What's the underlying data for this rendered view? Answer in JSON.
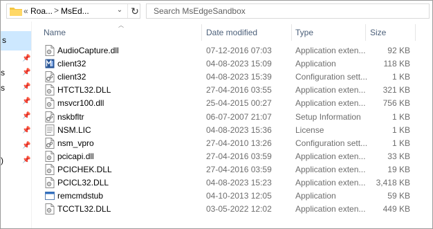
{
  "address": {
    "overflow": "«",
    "crumbs": [
      "Roa...",
      "MsEd..."
    ],
    "separator": ">",
    "dropdown": "⌄",
    "refresh": "↻"
  },
  "search": {
    "placeholder": "Search MsEdgeSandbox"
  },
  "nav": {
    "selected_fragment": "s",
    "fragments": [
      "s",
      "s",
      "s",
      ")"
    ]
  },
  "columns": {
    "name": "Name",
    "date": "Date modified",
    "type": "Type",
    "size": "Size"
  },
  "files": [
    {
      "name": "AudioCapture.dll",
      "date": "07-12-2016 07:03",
      "type": "Application exten...",
      "size": "92 KB",
      "icon": "dll-file-icon"
    },
    {
      "name": "client32",
      "date": "04-08-2023 15:09",
      "type": "Application",
      "size": "118 KB",
      "icon": "app-exe-icon"
    },
    {
      "name": "client32",
      "date": "04-08-2023 15:39",
      "type": "Configuration sett...",
      "size": "1 KB",
      "icon": "config-file-icon"
    },
    {
      "name": "HTCTL32.DLL",
      "date": "27-04-2016 03:55",
      "type": "Application exten...",
      "size": "321 KB",
      "icon": "dll-file-icon"
    },
    {
      "name": "msvcr100.dll",
      "date": "25-04-2015 00:27",
      "type": "Application exten...",
      "size": "756 KB",
      "icon": "dll-file-icon"
    },
    {
      "name": "nskbfltr",
      "date": "06-07-2007 21:07",
      "type": "Setup Information",
      "size": "1 KB",
      "icon": "setup-info-icon"
    },
    {
      "name": "NSM.LIC",
      "date": "04-08-2023 15:36",
      "type": "License",
      "size": "1 KB",
      "icon": "license-file-icon"
    },
    {
      "name": "nsm_vpro",
      "date": "27-04-2010 13:26",
      "type": "Configuration sett...",
      "size": "1 KB",
      "icon": "config-file-icon"
    },
    {
      "name": "pcicapi.dll",
      "date": "27-04-2016 03:59",
      "type": "Application exten...",
      "size": "33 KB",
      "icon": "dll-file-icon"
    },
    {
      "name": "PCICHEK.DLL",
      "date": "27-04-2016 03:59",
      "type": "Application exten...",
      "size": "19 KB",
      "icon": "dll-file-icon"
    },
    {
      "name": "PCICL32.DLL",
      "date": "04-08-2023 15:23",
      "type": "Application exten...",
      "size": "3,418 KB",
      "icon": "dll-file-icon"
    },
    {
      "name": "remcmdstub",
      "date": "04-10-2013 12:05",
      "type": "Application",
      "size": "59 KB",
      "icon": "app-window-icon"
    },
    {
      "name": "TCCTL32.DLL",
      "date": "03-05-2022 12:02",
      "type": "Application exten...",
      "size": "449 KB",
      "icon": "dll-file-icon"
    }
  ],
  "colors": {
    "header_text": "#4c607a",
    "nav_selected": "#cde8ff",
    "secondary_text": "#6d6d6d"
  }
}
